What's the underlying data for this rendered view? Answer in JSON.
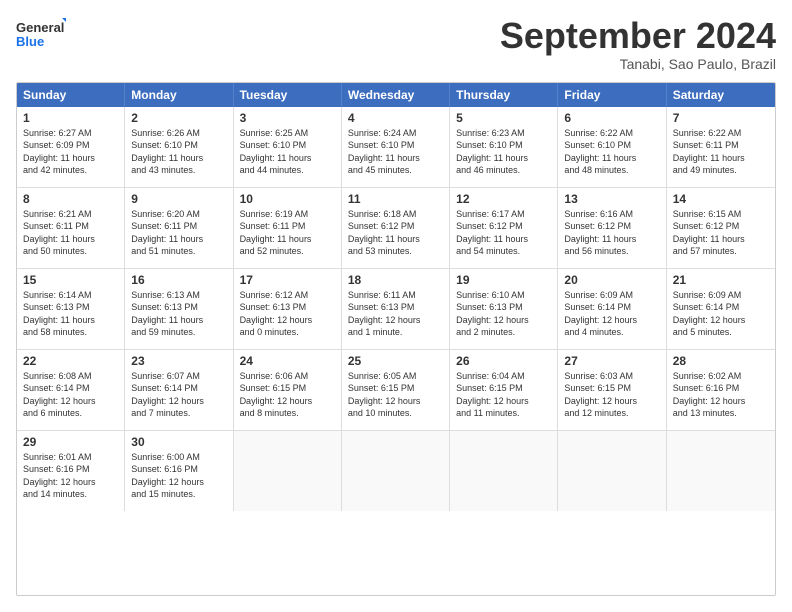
{
  "logo": {
    "line1": "General",
    "line2": "Blue"
  },
  "title": "September 2024",
  "subtitle": "Tanabi, Sao Paulo, Brazil",
  "header_days": [
    "Sunday",
    "Monday",
    "Tuesday",
    "Wednesday",
    "Thursday",
    "Friday",
    "Saturday"
  ],
  "weeks": [
    [
      {
        "day": "1",
        "lines": [
          "Sunrise: 6:27 AM",
          "Sunset: 6:09 PM",
          "Daylight: 11 hours",
          "and 42 minutes."
        ]
      },
      {
        "day": "2",
        "lines": [
          "Sunrise: 6:26 AM",
          "Sunset: 6:10 PM",
          "Daylight: 11 hours",
          "and 43 minutes."
        ]
      },
      {
        "day": "3",
        "lines": [
          "Sunrise: 6:25 AM",
          "Sunset: 6:10 PM",
          "Daylight: 11 hours",
          "and 44 minutes."
        ]
      },
      {
        "day": "4",
        "lines": [
          "Sunrise: 6:24 AM",
          "Sunset: 6:10 PM",
          "Daylight: 11 hours",
          "and 45 minutes."
        ]
      },
      {
        "day": "5",
        "lines": [
          "Sunrise: 6:23 AM",
          "Sunset: 6:10 PM",
          "Daylight: 11 hours",
          "and 46 minutes."
        ]
      },
      {
        "day": "6",
        "lines": [
          "Sunrise: 6:22 AM",
          "Sunset: 6:10 PM",
          "Daylight: 11 hours",
          "and 48 minutes."
        ]
      },
      {
        "day": "7",
        "lines": [
          "Sunrise: 6:22 AM",
          "Sunset: 6:11 PM",
          "Daylight: 11 hours",
          "and 49 minutes."
        ]
      }
    ],
    [
      {
        "day": "8",
        "lines": [
          "Sunrise: 6:21 AM",
          "Sunset: 6:11 PM",
          "Daylight: 11 hours",
          "and 50 minutes."
        ]
      },
      {
        "day": "9",
        "lines": [
          "Sunrise: 6:20 AM",
          "Sunset: 6:11 PM",
          "Daylight: 11 hours",
          "and 51 minutes."
        ]
      },
      {
        "day": "10",
        "lines": [
          "Sunrise: 6:19 AM",
          "Sunset: 6:11 PM",
          "Daylight: 11 hours",
          "and 52 minutes."
        ]
      },
      {
        "day": "11",
        "lines": [
          "Sunrise: 6:18 AM",
          "Sunset: 6:12 PM",
          "Daylight: 11 hours",
          "and 53 minutes."
        ]
      },
      {
        "day": "12",
        "lines": [
          "Sunrise: 6:17 AM",
          "Sunset: 6:12 PM",
          "Daylight: 11 hours",
          "and 54 minutes."
        ]
      },
      {
        "day": "13",
        "lines": [
          "Sunrise: 6:16 AM",
          "Sunset: 6:12 PM",
          "Daylight: 11 hours",
          "and 56 minutes."
        ]
      },
      {
        "day": "14",
        "lines": [
          "Sunrise: 6:15 AM",
          "Sunset: 6:12 PM",
          "Daylight: 11 hours",
          "and 57 minutes."
        ]
      }
    ],
    [
      {
        "day": "15",
        "lines": [
          "Sunrise: 6:14 AM",
          "Sunset: 6:13 PM",
          "Daylight: 11 hours",
          "and 58 minutes."
        ]
      },
      {
        "day": "16",
        "lines": [
          "Sunrise: 6:13 AM",
          "Sunset: 6:13 PM",
          "Daylight: 11 hours",
          "and 59 minutes."
        ]
      },
      {
        "day": "17",
        "lines": [
          "Sunrise: 6:12 AM",
          "Sunset: 6:13 PM",
          "Daylight: 12 hours",
          "and 0 minutes."
        ]
      },
      {
        "day": "18",
        "lines": [
          "Sunrise: 6:11 AM",
          "Sunset: 6:13 PM",
          "Daylight: 12 hours",
          "and 1 minute."
        ]
      },
      {
        "day": "19",
        "lines": [
          "Sunrise: 6:10 AM",
          "Sunset: 6:13 PM",
          "Daylight: 12 hours",
          "and 2 minutes."
        ]
      },
      {
        "day": "20",
        "lines": [
          "Sunrise: 6:09 AM",
          "Sunset: 6:14 PM",
          "Daylight: 12 hours",
          "and 4 minutes."
        ]
      },
      {
        "day": "21",
        "lines": [
          "Sunrise: 6:09 AM",
          "Sunset: 6:14 PM",
          "Daylight: 12 hours",
          "and 5 minutes."
        ]
      }
    ],
    [
      {
        "day": "22",
        "lines": [
          "Sunrise: 6:08 AM",
          "Sunset: 6:14 PM",
          "Daylight: 12 hours",
          "and 6 minutes."
        ]
      },
      {
        "day": "23",
        "lines": [
          "Sunrise: 6:07 AM",
          "Sunset: 6:14 PM",
          "Daylight: 12 hours",
          "and 7 minutes."
        ]
      },
      {
        "day": "24",
        "lines": [
          "Sunrise: 6:06 AM",
          "Sunset: 6:15 PM",
          "Daylight: 12 hours",
          "and 8 minutes."
        ]
      },
      {
        "day": "25",
        "lines": [
          "Sunrise: 6:05 AM",
          "Sunset: 6:15 PM",
          "Daylight: 12 hours",
          "and 10 minutes."
        ]
      },
      {
        "day": "26",
        "lines": [
          "Sunrise: 6:04 AM",
          "Sunset: 6:15 PM",
          "Daylight: 12 hours",
          "and 11 minutes."
        ]
      },
      {
        "day": "27",
        "lines": [
          "Sunrise: 6:03 AM",
          "Sunset: 6:15 PM",
          "Daylight: 12 hours",
          "and 12 minutes."
        ]
      },
      {
        "day": "28",
        "lines": [
          "Sunrise: 6:02 AM",
          "Sunset: 6:16 PM",
          "Daylight: 12 hours",
          "and 13 minutes."
        ]
      }
    ],
    [
      {
        "day": "29",
        "lines": [
          "Sunrise: 6:01 AM",
          "Sunset: 6:16 PM",
          "Daylight: 12 hours",
          "and 14 minutes."
        ]
      },
      {
        "day": "30",
        "lines": [
          "Sunrise: 6:00 AM",
          "Sunset: 6:16 PM",
          "Daylight: 12 hours",
          "and 15 minutes."
        ]
      },
      {
        "day": "",
        "lines": []
      },
      {
        "day": "",
        "lines": []
      },
      {
        "day": "",
        "lines": []
      },
      {
        "day": "",
        "lines": []
      },
      {
        "day": "",
        "lines": []
      }
    ]
  ]
}
